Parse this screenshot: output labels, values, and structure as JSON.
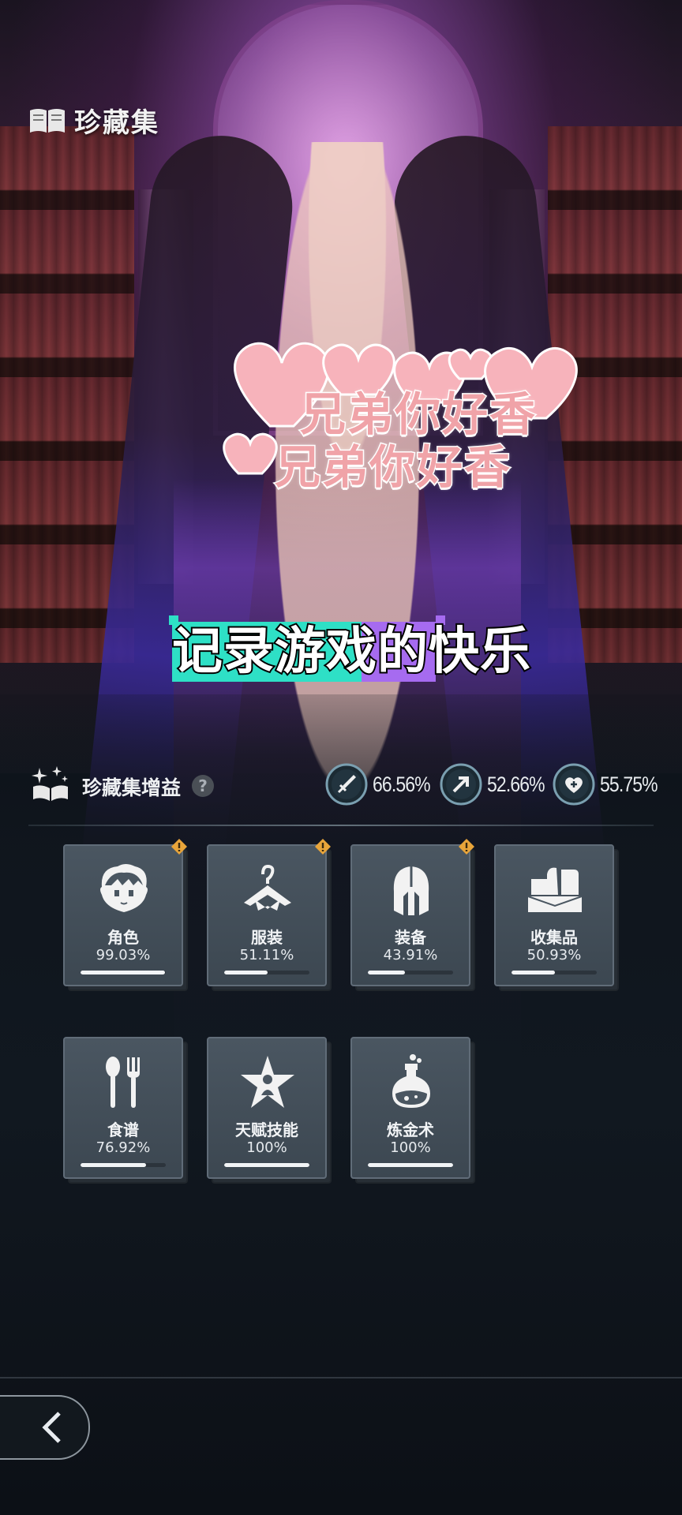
{
  "header": {
    "title": "珍藏集",
    "icon": "open-book-icon"
  },
  "overlay_text": {
    "heart_line_1": "兄弟你好香",
    "heart_line_2": "兄弟你好香",
    "caption": "记录游戏的快乐"
  },
  "bonus": {
    "label": "珍藏集增益",
    "help": "?",
    "stats": [
      {
        "icon": "sword-icon",
        "value": "66.56%"
      },
      {
        "icon": "arrow-up-right-icon",
        "value": "52.66%"
      },
      {
        "icon": "heart-plus-icon",
        "value": "55.75%"
      }
    ]
  },
  "categories": [
    {
      "label": "角色",
      "percent": "99.03%",
      "progress": 0.9903,
      "alert": true,
      "icon": "character-face-icon"
    },
    {
      "label": "服装",
      "percent": "51.11%",
      "progress": 0.5111,
      "alert": true,
      "icon": "hanger-icon"
    },
    {
      "label": "装备",
      "percent": "43.91%",
      "progress": 0.4391,
      "alert": true,
      "icon": "helmet-icon"
    },
    {
      "label": "收集品",
      "percent": "50.93%",
      "progress": 0.5093,
      "alert": false,
      "icon": "collectibles-icon"
    },
    {
      "label": "食谱",
      "percent": "76.92%",
      "progress": 0.7692,
      "alert": false,
      "icon": "spoon-fork-icon"
    },
    {
      "label": "天赋技能",
      "percent": "100%",
      "progress": 1.0,
      "alert": false,
      "icon": "talent-star-icon"
    },
    {
      "label": "炼金术",
      "percent": "100%",
      "progress": 1.0,
      "alert": false,
      "icon": "potion-flask-icon"
    }
  ],
  "colors": {
    "card_bg": "#46525d",
    "alert": "#e9a53a",
    "caption_teal": "#2ee0c6",
    "caption_purple": "#a66bf0",
    "heart_pink": "#f7a9b4"
  },
  "navigation": {
    "back_icon": "chevron-left-icon"
  }
}
